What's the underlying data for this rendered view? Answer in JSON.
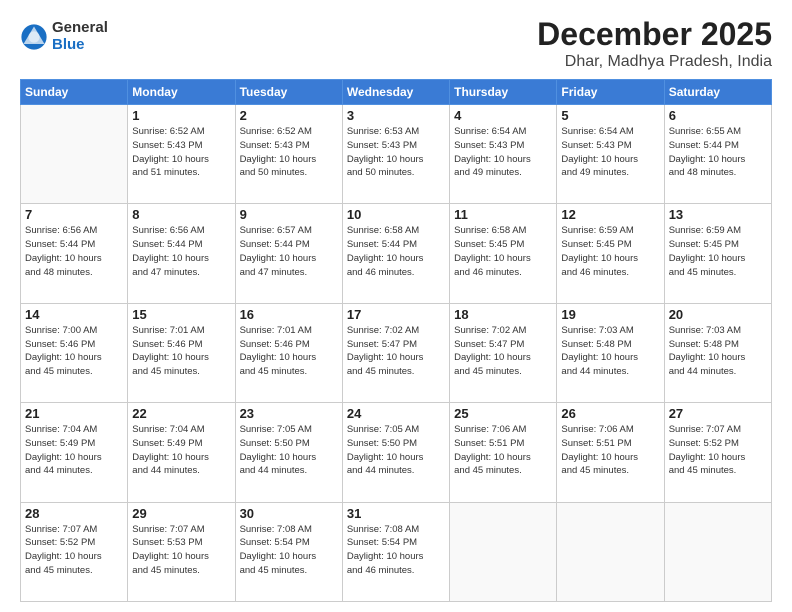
{
  "logo": {
    "general": "General",
    "blue": "Blue"
  },
  "title": "December 2025",
  "subtitle": "Dhar, Madhya Pradesh, India",
  "days_header": [
    "Sunday",
    "Monday",
    "Tuesday",
    "Wednesday",
    "Thursday",
    "Friday",
    "Saturday"
  ],
  "weeks": [
    [
      {
        "day": "",
        "info": ""
      },
      {
        "day": "1",
        "info": "Sunrise: 6:52 AM\nSunset: 5:43 PM\nDaylight: 10 hours\nand 51 minutes."
      },
      {
        "day": "2",
        "info": "Sunrise: 6:52 AM\nSunset: 5:43 PM\nDaylight: 10 hours\nand 50 minutes."
      },
      {
        "day": "3",
        "info": "Sunrise: 6:53 AM\nSunset: 5:43 PM\nDaylight: 10 hours\nand 50 minutes."
      },
      {
        "day": "4",
        "info": "Sunrise: 6:54 AM\nSunset: 5:43 PM\nDaylight: 10 hours\nand 49 minutes."
      },
      {
        "day": "5",
        "info": "Sunrise: 6:54 AM\nSunset: 5:43 PM\nDaylight: 10 hours\nand 49 minutes."
      },
      {
        "day": "6",
        "info": "Sunrise: 6:55 AM\nSunset: 5:44 PM\nDaylight: 10 hours\nand 48 minutes."
      }
    ],
    [
      {
        "day": "7",
        "info": "Sunrise: 6:56 AM\nSunset: 5:44 PM\nDaylight: 10 hours\nand 48 minutes."
      },
      {
        "day": "8",
        "info": "Sunrise: 6:56 AM\nSunset: 5:44 PM\nDaylight: 10 hours\nand 47 minutes."
      },
      {
        "day": "9",
        "info": "Sunrise: 6:57 AM\nSunset: 5:44 PM\nDaylight: 10 hours\nand 47 minutes."
      },
      {
        "day": "10",
        "info": "Sunrise: 6:58 AM\nSunset: 5:44 PM\nDaylight: 10 hours\nand 46 minutes."
      },
      {
        "day": "11",
        "info": "Sunrise: 6:58 AM\nSunset: 5:45 PM\nDaylight: 10 hours\nand 46 minutes."
      },
      {
        "day": "12",
        "info": "Sunrise: 6:59 AM\nSunset: 5:45 PM\nDaylight: 10 hours\nand 46 minutes."
      },
      {
        "day": "13",
        "info": "Sunrise: 6:59 AM\nSunset: 5:45 PM\nDaylight: 10 hours\nand 45 minutes."
      }
    ],
    [
      {
        "day": "14",
        "info": "Sunrise: 7:00 AM\nSunset: 5:46 PM\nDaylight: 10 hours\nand 45 minutes."
      },
      {
        "day": "15",
        "info": "Sunrise: 7:01 AM\nSunset: 5:46 PM\nDaylight: 10 hours\nand 45 minutes."
      },
      {
        "day": "16",
        "info": "Sunrise: 7:01 AM\nSunset: 5:46 PM\nDaylight: 10 hours\nand 45 minutes."
      },
      {
        "day": "17",
        "info": "Sunrise: 7:02 AM\nSunset: 5:47 PM\nDaylight: 10 hours\nand 45 minutes."
      },
      {
        "day": "18",
        "info": "Sunrise: 7:02 AM\nSunset: 5:47 PM\nDaylight: 10 hours\nand 45 minutes."
      },
      {
        "day": "19",
        "info": "Sunrise: 7:03 AM\nSunset: 5:48 PM\nDaylight: 10 hours\nand 44 minutes."
      },
      {
        "day": "20",
        "info": "Sunrise: 7:03 AM\nSunset: 5:48 PM\nDaylight: 10 hours\nand 44 minutes."
      }
    ],
    [
      {
        "day": "21",
        "info": "Sunrise: 7:04 AM\nSunset: 5:49 PM\nDaylight: 10 hours\nand 44 minutes."
      },
      {
        "day": "22",
        "info": "Sunrise: 7:04 AM\nSunset: 5:49 PM\nDaylight: 10 hours\nand 44 minutes."
      },
      {
        "day": "23",
        "info": "Sunrise: 7:05 AM\nSunset: 5:50 PM\nDaylight: 10 hours\nand 44 minutes."
      },
      {
        "day": "24",
        "info": "Sunrise: 7:05 AM\nSunset: 5:50 PM\nDaylight: 10 hours\nand 44 minutes."
      },
      {
        "day": "25",
        "info": "Sunrise: 7:06 AM\nSunset: 5:51 PM\nDaylight: 10 hours\nand 45 minutes."
      },
      {
        "day": "26",
        "info": "Sunrise: 7:06 AM\nSunset: 5:51 PM\nDaylight: 10 hours\nand 45 minutes."
      },
      {
        "day": "27",
        "info": "Sunrise: 7:07 AM\nSunset: 5:52 PM\nDaylight: 10 hours\nand 45 minutes."
      }
    ],
    [
      {
        "day": "28",
        "info": "Sunrise: 7:07 AM\nSunset: 5:52 PM\nDaylight: 10 hours\nand 45 minutes."
      },
      {
        "day": "29",
        "info": "Sunrise: 7:07 AM\nSunset: 5:53 PM\nDaylight: 10 hours\nand 45 minutes."
      },
      {
        "day": "30",
        "info": "Sunrise: 7:08 AM\nSunset: 5:54 PM\nDaylight: 10 hours\nand 45 minutes."
      },
      {
        "day": "31",
        "info": "Sunrise: 7:08 AM\nSunset: 5:54 PM\nDaylight: 10 hours\nand 46 minutes."
      },
      {
        "day": "",
        "info": ""
      },
      {
        "day": "",
        "info": ""
      },
      {
        "day": "",
        "info": ""
      }
    ]
  ]
}
